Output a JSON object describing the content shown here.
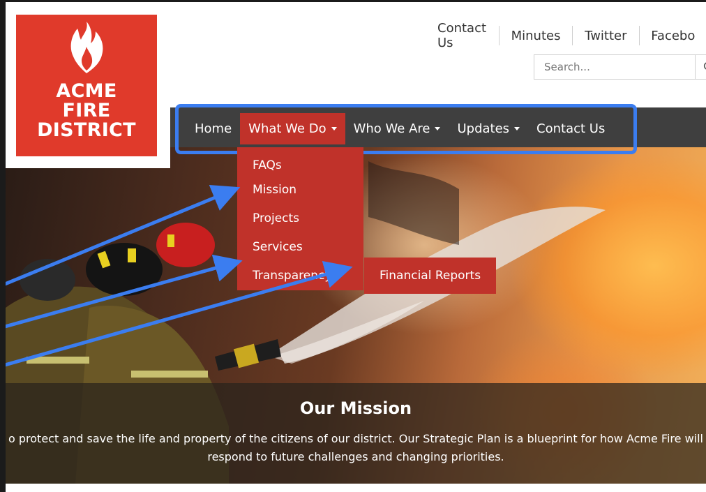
{
  "logo": {
    "line1": "ACME",
    "line2": "FIRE",
    "line3": "DISTRICT"
  },
  "utility_links": [
    "Contact Us",
    "Minutes",
    "Twitter",
    "Facebo"
  ],
  "search": {
    "placeholder": "Search..."
  },
  "nav": {
    "items": [
      {
        "label": "Home",
        "active": false,
        "dropdown": false
      },
      {
        "label": "What We Do",
        "active": true,
        "dropdown": true
      },
      {
        "label": "Who We Are",
        "active": false,
        "dropdown": true
      },
      {
        "label": "Updates",
        "active": false,
        "dropdown": true
      },
      {
        "label": "Contact Us",
        "active": false,
        "dropdown": false
      }
    ]
  },
  "dropdown": {
    "items": [
      "FAQs",
      "Mission",
      "Projects",
      "Services",
      "Transparency"
    ],
    "submenu": "Financial Reports"
  },
  "hero": {
    "title": "Our Mission",
    "text_line1": "o protect and save the life and property of the citizens of our district. Our Strategic Plan is a blueprint for how Acme Fire will",
    "text_line2": "respond to future challenges and changing priorities."
  },
  "colors": {
    "accent_red": "#c0322a",
    "logo_red": "#e03a2b",
    "nav_bg": "#3f3f3f",
    "highlight_blue": "#3b7df0"
  }
}
